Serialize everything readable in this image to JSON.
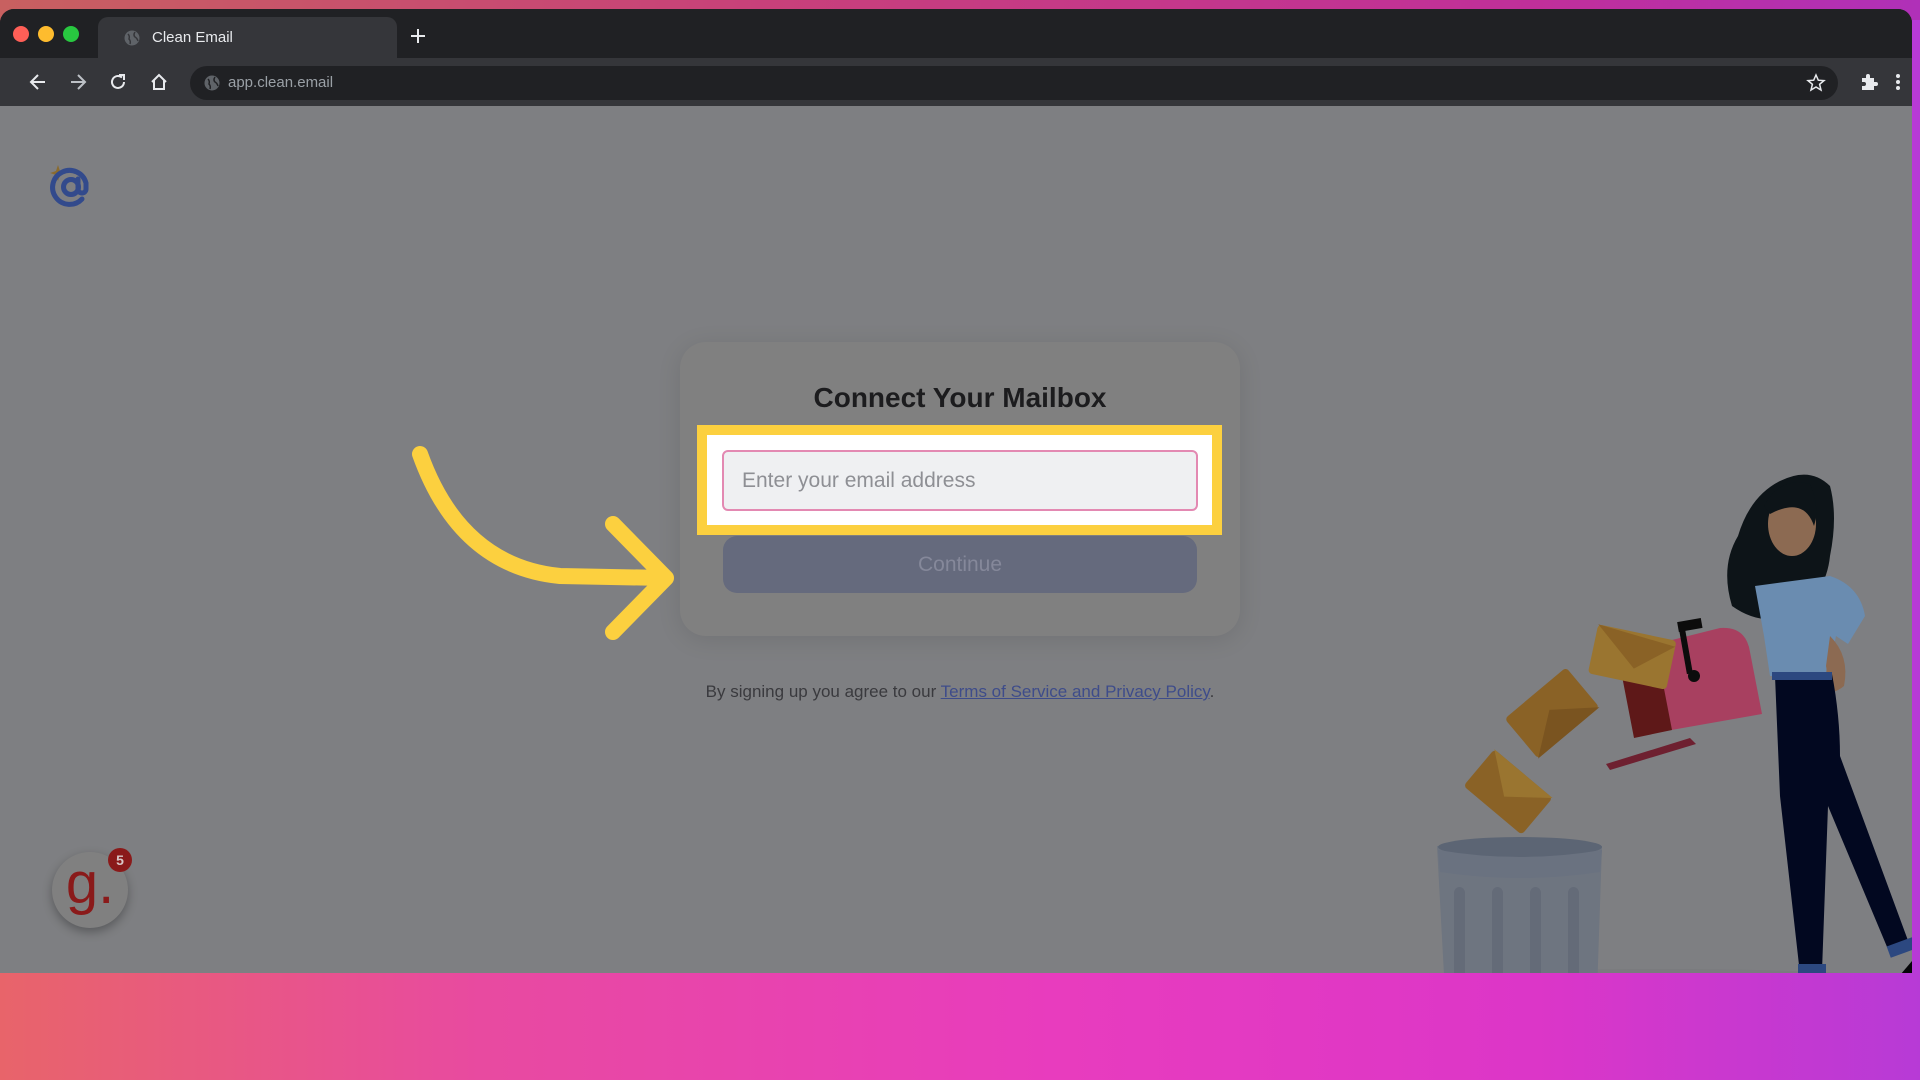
{
  "browser": {
    "tab_title": "Clean Email",
    "new_tab_label": "+",
    "url": "app.clean.email",
    "icons": {
      "close": "close-dot",
      "minimize": "minimize-dot",
      "maximize": "maximize-dot",
      "back": "arrow-left",
      "forward": "arrow-right",
      "reload": "reload",
      "home": "home",
      "bookmark": "star",
      "extensions": "puzzle",
      "menu": "kebab"
    },
    "colors": {
      "close": "#ff5f57",
      "minimize": "#febc2e",
      "maximize": "#28c840"
    }
  },
  "page": {
    "logo_icon": "at-sign-sparkle",
    "card": {
      "title": "Connect Your Mailbox",
      "email_placeholder": "Enter your email address",
      "email_value": "",
      "continue_label": "Continue"
    },
    "terms": {
      "prefix": "By signing up you agree to our ",
      "link_label": "Terms of Service and Privacy Policy",
      "suffix": "."
    },
    "annotation": {
      "highlight_color": "#fcd03f",
      "arrow_color": "#fcd03f"
    },
    "widget": {
      "letter": "g.",
      "badge_count": "5"
    },
    "colors": {
      "accent_pink": "#e389b2",
      "link": "#3e4c8a",
      "button": "#656a7d"
    }
  }
}
